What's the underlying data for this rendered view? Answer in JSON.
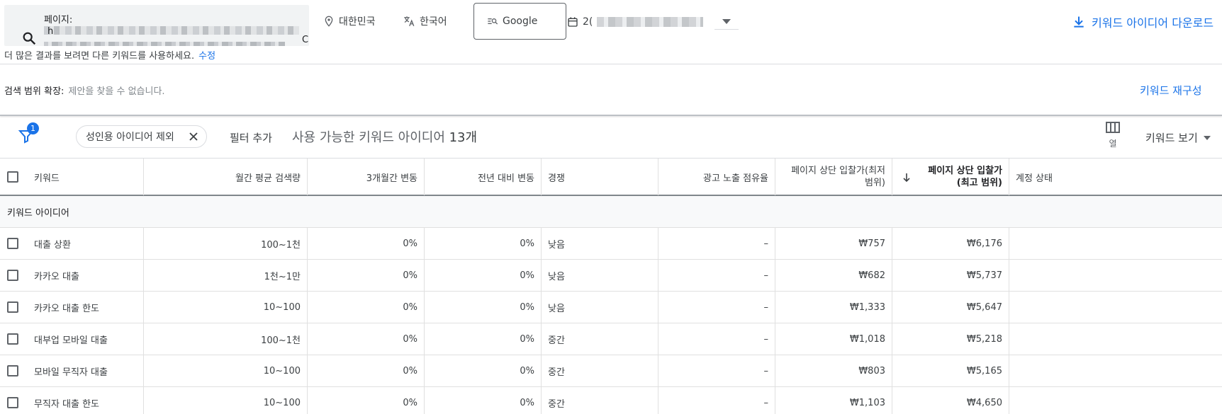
{
  "topbar": {
    "page_label": "페이지:",
    "url_prefix": "h",
    "url_suffix": "C",
    "location": "대한민국",
    "language": "한국어",
    "engine": "Google",
    "date_prefix": "2(",
    "download": "키워드 아이디어 다운로드"
  },
  "hint": {
    "text": "더 많은 결과를 보려면 다른 키워드를 사용하세요.",
    "edit": "수정"
  },
  "expand": {
    "label": "검색 범위 확장:",
    "empty": "제안을 찾을 수 없습니다.",
    "rebuild": "키워드 재구성"
  },
  "filters": {
    "badge": "1",
    "chip": "성인용 아이디어 제외",
    "add": "필터 추가",
    "count_prefix": "사용 가능한 키워드 아이디어 ",
    "count_num": "13개",
    "columns": "열",
    "view": "키워드 보기"
  },
  "table": {
    "headers": [
      "키워드",
      "월간 평균 검색량",
      "3개월간 변동",
      "전년 대비 변동",
      "경쟁",
      "광고 노출 점유율",
      "페이지 상단 입찰가(최저 범위)",
      "페이지 상단 입찰가 (최고 범위)",
      "계정 상태"
    ],
    "header_low_l1": "페이지 상단 입찰가(최저",
    "header_low_l2": "범위)",
    "header_high_l1": "페이지 상단 입찰가",
    "header_high_l2": "(최고 범위)",
    "section": "키워드 아이디어",
    "rows": [
      {
        "keyword": "대출 상환",
        "volume": "100~1천",
        "m3": "0%",
        "yoy": "0%",
        "comp": "낮음",
        "share": "–",
        "low": "₩757",
        "high": "₩6,176"
      },
      {
        "keyword": "카카오 대출",
        "volume": "1천~1만",
        "m3": "0%",
        "yoy": "0%",
        "comp": "낮음",
        "share": "–",
        "low": "₩682",
        "high": "₩5,737"
      },
      {
        "keyword": "카카오 대출 한도",
        "volume": "10~100",
        "m3": "0%",
        "yoy": "0%",
        "comp": "낮음",
        "share": "–",
        "low": "₩1,333",
        "high": "₩5,647"
      },
      {
        "keyword": "대부업 모바일 대출",
        "volume": "100~1천",
        "m3": "0%",
        "yoy": "0%",
        "comp": "중간",
        "share": "–",
        "low": "₩1,018",
        "high": "₩5,218"
      },
      {
        "keyword": "모바일 무직자 대출",
        "volume": "10~100",
        "m3": "0%",
        "yoy": "0%",
        "comp": "중간",
        "share": "–",
        "low": "₩803",
        "high": "₩5,165"
      },
      {
        "keyword": "무직자 대출 한도",
        "volume": "10~100",
        "m3": "0%",
        "yoy": "0%",
        "comp": "중간",
        "share": "–",
        "low": "₩1,103",
        "high": "₩4,650"
      }
    ]
  },
  "colors": {
    "accent": "#1a73e8",
    "text": "#3c4043",
    "border": "#dadce0"
  }
}
